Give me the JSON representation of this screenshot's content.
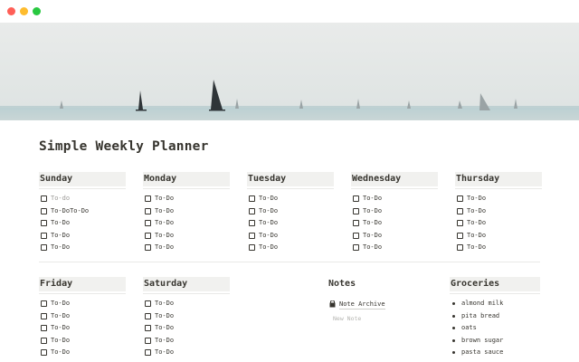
{
  "window": {
    "controls": [
      "close",
      "minimize",
      "zoom"
    ],
    "colors": {
      "close": "#ff5f57",
      "minimize": "#febc2e",
      "zoom": "#28c840"
    }
  },
  "cover": {
    "icon": "sailboats-sea-image"
  },
  "page": {
    "title": "Simple Weekly Planner"
  },
  "days_row1": [
    {
      "name": "Sunday",
      "items": [
        {
          "label": "To-do",
          "placeholder": true
        },
        {
          "label": "To-DoTo-Do",
          "placeholder": false
        },
        {
          "label": "To-Do",
          "placeholder": false
        },
        {
          "label": "To-Do",
          "placeholder": false
        },
        {
          "label": "To-Do",
          "placeholder": false
        }
      ]
    },
    {
      "name": "Monday",
      "items": [
        {
          "label": "To-Do"
        },
        {
          "label": "To-Do"
        },
        {
          "label": "To-Do"
        },
        {
          "label": "To-Do"
        },
        {
          "label": "To-Do"
        }
      ]
    },
    {
      "name": "Tuesday",
      "items": [
        {
          "label": "To-Do"
        },
        {
          "label": "To-Do"
        },
        {
          "label": "To-Do"
        },
        {
          "label": "To-Do"
        },
        {
          "label": "To-Do"
        }
      ]
    },
    {
      "name": "Wednesday",
      "items": [
        {
          "label": "To-Do"
        },
        {
          "label": "To-Do"
        },
        {
          "label": "To-Do"
        },
        {
          "label": "To-Do"
        },
        {
          "label": "To-Do"
        }
      ]
    },
    {
      "name": "Thursday",
      "items": [
        {
          "label": "To-Do"
        },
        {
          "label": "To-Do"
        },
        {
          "label": "To-Do"
        },
        {
          "label": "To-Do"
        },
        {
          "label": "To-Do"
        }
      ]
    }
  ],
  "days_row2": [
    {
      "name": "Friday",
      "items": [
        {
          "label": "To-Do"
        },
        {
          "label": "To-Do"
        },
        {
          "label": "To-Do"
        },
        {
          "label": "To-Do"
        },
        {
          "label": "To-Do"
        }
      ]
    },
    {
      "name": "Saturday",
      "items": [
        {
          "label": "To-Do"
        },
        {
          "label": "To-Do"
        },
        {
          "label": "To-Do"
        },
        {
          "label": "To-Do"
        },
        {
          "label": "To-Do"
        }
      ]
    }
  ],
  "notes": {
    "heading": "Notes",
    "archive_label": "Note Archive",
    "archive_icon": "document-icon",
    "new_note_placeholder": "New Note"
  },
  "groceries": {
    "heading": "Groceries",
    "items": [
      "almond milk",
      "pita bread",
      "oats",
      "brown sugar",
      "pasta sauce"
    ]
  }
}
